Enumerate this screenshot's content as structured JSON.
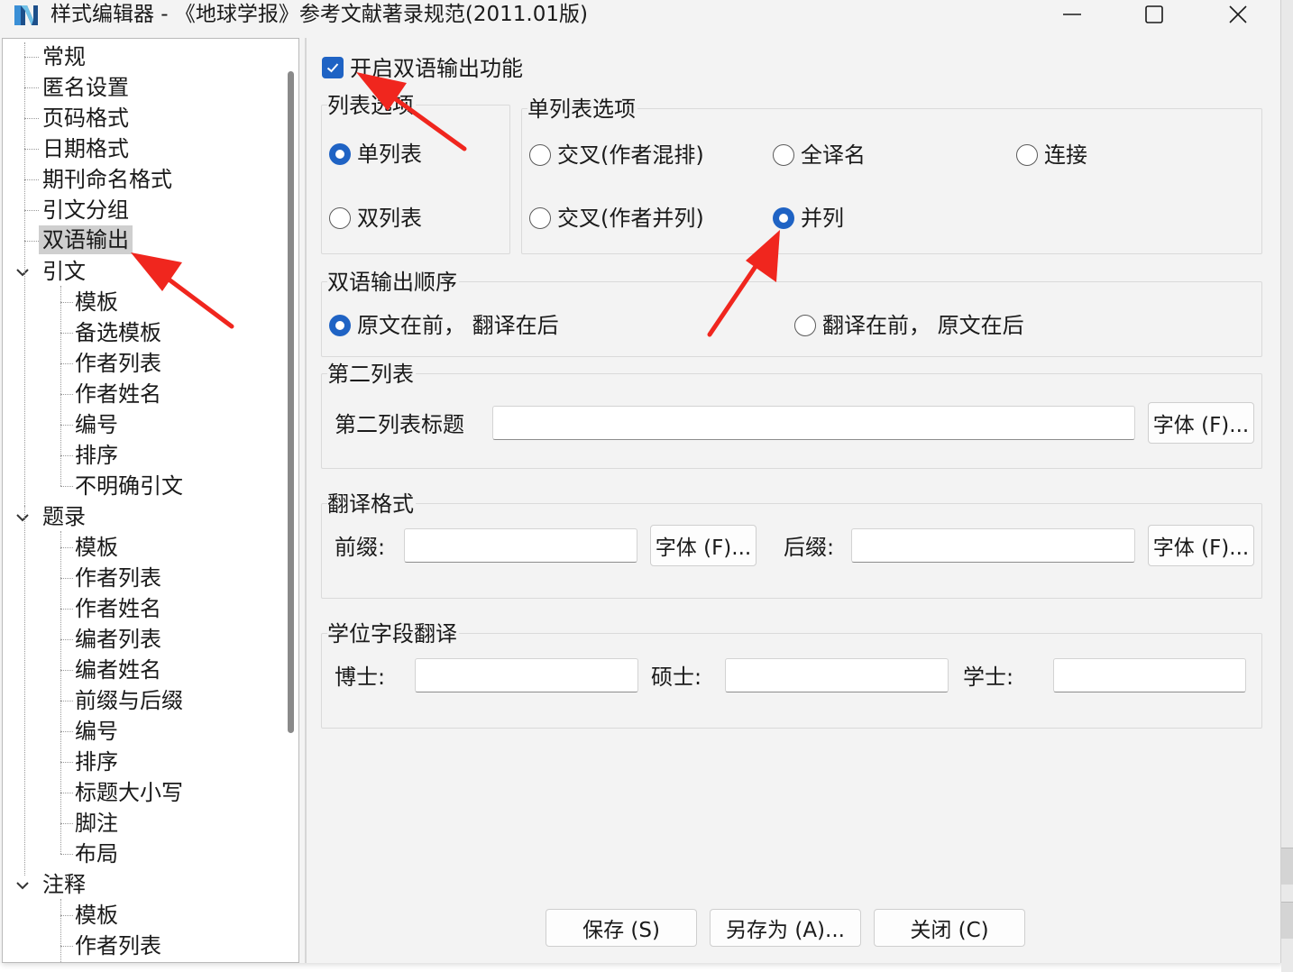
{
  "window": {
    "title": "样式编辑器 - 《地球学报》参考文献著录规范(2011.01版)",
    "controls": [
      "minimize",
      "maximize",
      "close"
    ]
  },
  "tree": {
    "top_items": [
      "常规",
      "匿名设置",
      "页码格式",
      "日期格式",
      "期刊命名格式",
      "引文分组",
      "双语输出"
    ],
    "selected": "双语输出",
    "groups": [
      {
        "label": "引文",
        "expanded": true,
        "children": [
          "模板",
          "备选模板",
          "作者列表",
          "作者姓名",
          "编号",
          "排序",
          "不明确引文"
        ]
      },
      {
        "label": "题录",
        "expanded": true,
        "children": [
          "模板",
          "作者列表",
          "作者姓名",
          "编者列表",
          "编者姓名",
          "前缀与后缀",
          "编号",
          "排序",
          "标题大小写",
          "脚注",
          "布局"
        ]
      },
      {
        "label": "注释",
        "expanded": true,
        "children": [
          "模板",
          "作者列表"
        ]
      }
    ]
  },
  "bilingual": {
    "enable_label": "开启双语输出功能",
    "enabled": true,
    "list_options": {
      "title": "列表选项",
      "options": [
        {
          "label": "单列表",
          "selected": true
        },
        {
          "label": "双列表",
          "selected": false
        }
      ]
    },
    "single_list_options": {
      "title": "单列表选项",
      "options": [
        {
          "label": "交叉(作者混排)",
          "selected": false
        },
        {
          "label": "全译名",
          "selected": false
        },
        {
          "label": "连接",
          "selected": false
        },
        {
          "label": "交叉(作者并列)",
          "selected": false
        },
        {
          "label": "并列",
          "selected": true
        }
      ]
    },
    "order": {
      "title": "双语输出顺序",
      "options": [
        {
          "label": "原文在前， 翻译在后",
          "selected": true
        },
        {
          "label": "翻译在前， 原文在后",
          "selected": false
        }
      ]
    },
    "second_list": {
      "title": "第二列表",
      "field_label": "第二列表标题",
      "field_value": "",
      "font_button": "字体 (F)..."
    },
    "translation_format": {
      "title": "翻译格式",
      "prefix_label": "前缀:",
      "prefix_value": "",
      "prefix_font_button": "字体 (F)...",
      "suffix_label": "后缀:",
      "suffix_value": "",
      "suffix_font_button": "字体 (F)..."
    },
    "degree_translation": {
      "title": "学位字段翻译",
      "doctor_label": "博士:",
      "doctor_value": "",
      "master_label": "硕士:",
      "master_value": "",
      "bachelor_label": "学士:",
      "bachelor_value": ""
    }
  },
  "footer": {
    "save": "保存 (S)",
    "save_as": "另存为 (A)...",
    "close": "关闭 (C)"
  },
  "colors": {
    "accent": "#1f63c4",
    "annotation_arrow": "#f0261e",
    "selected_row": "#cfcfcf",
    "window_bg": "#f3f3f3"
  }
}
